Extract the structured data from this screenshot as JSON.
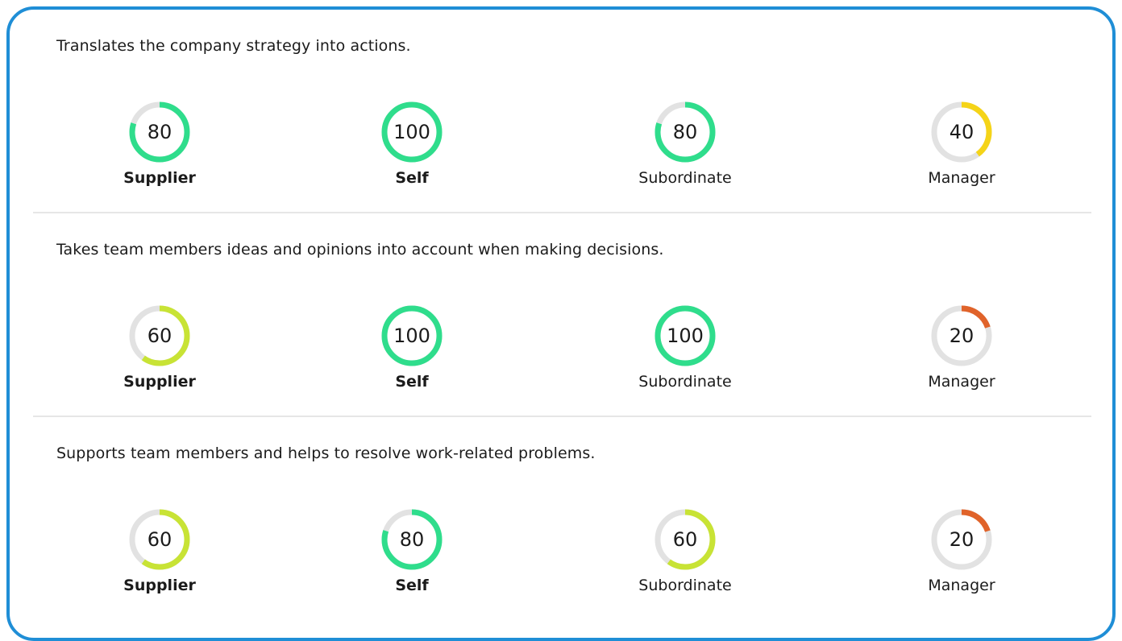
{
  "colors": {
    "frame": "#1f8ed6",
    "track": "#e2e2e2",
    "score_100": "#2fdd8c",
    "score_80": "#2fdd8c",
    "score_60": "#c8e335",
    "score_40": "#f5d418",
    "score_20": "#e0632a"
  },
  "sections": [
    {
      "question": "Translates the company strategy into actions.",
      "ratings": [
        {
          "label": "Supplier",
          "score": 80,
          "bold": true
        },
        {
          "label": "Self",
          "score": 100,
          "bold": true
        },
        {
          "label": "Subordinate",
          "score": 80,
          "bold": false
        },
        {
          "label": "Manager",
          "score": 40,
          "bold": false
        }
      ]
    },
    {
      "question": "Takes team members ideas and opinions into account when making decisions.",
      "ratings": [
        {
          "label": "Supplier",
          "score": 60,
          "bold": true
        },
        {
          "label": "Self",
          "score": 100,
          "bold": true
        },
        {
          "label": "Subordinate",
          "score": 100,
          "bold": false
        },
        {
          "label": "Manager",
          "score": 20,
          "bold": false
        }
      ]
    },
    {
      "question": "Supports team members and helps to resolve work-related problems.",
      "ratings": [
        {
          "label": "Supplier",
          "score": 60,
          "bold": true
        },
        {
          "label": "Self",
          "score": 80,
          "bold": true
        },
        {
          "label": "Subordinate",
          "score": 60,
          "bold": false
        },
        {
          "label": "Manager",
          "score": 20,
          "bold": false
        }
      ]
    }
  ]
}
